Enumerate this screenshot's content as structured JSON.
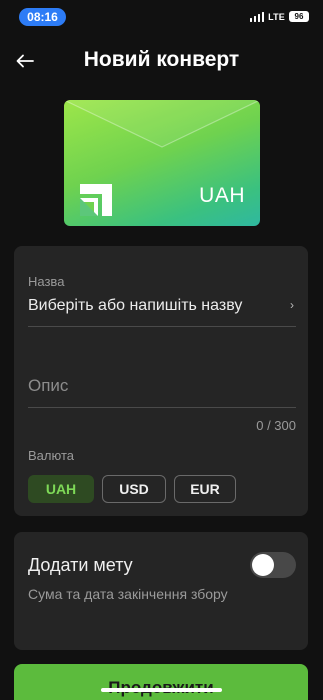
{
  "status_bar": {
    "time": "08:16",
    "network": "LTE",
    "battery": "96"
  },
  "header": {
    "title": "Новий конверт",
    "back_icon": "arrow-left-icon"
  },
  "envelope": {
    "currency": "UAH",
    "logo_icon": "privatbank-logo-icon",
    "colors": {
      "start": "#9de64a",
      "end": "#2fb8a0"
    }
  },
  "form": {
    "name_label": "Назва",
    "name_value": "Виберіть або напишіть назву",
    "description_placeholder": "Опис",
    "description_counter": "0 / 300",
    "currency_label": "Валюта",
    "currencies": [
      {
        "label": "UAH",
        "selected": true
      },
      {
        "label": "USD",
        "selected": false
      },
      {
        "label": "EUR",
        "selected": false
      }
    ]
  },
  "goal": {
    "title": "Додати мету",
    "subtitle": "Сума та дата закінчення збору",
    "enabled": false
  },
  "continue_button": {
    "label": "Продовжити",
    "color": "#5cbb3d"
  },
  "colors": {
    "accent": "#5cbb3d",
    "background": "#111111",
    "card": "#252525"
  }
}
